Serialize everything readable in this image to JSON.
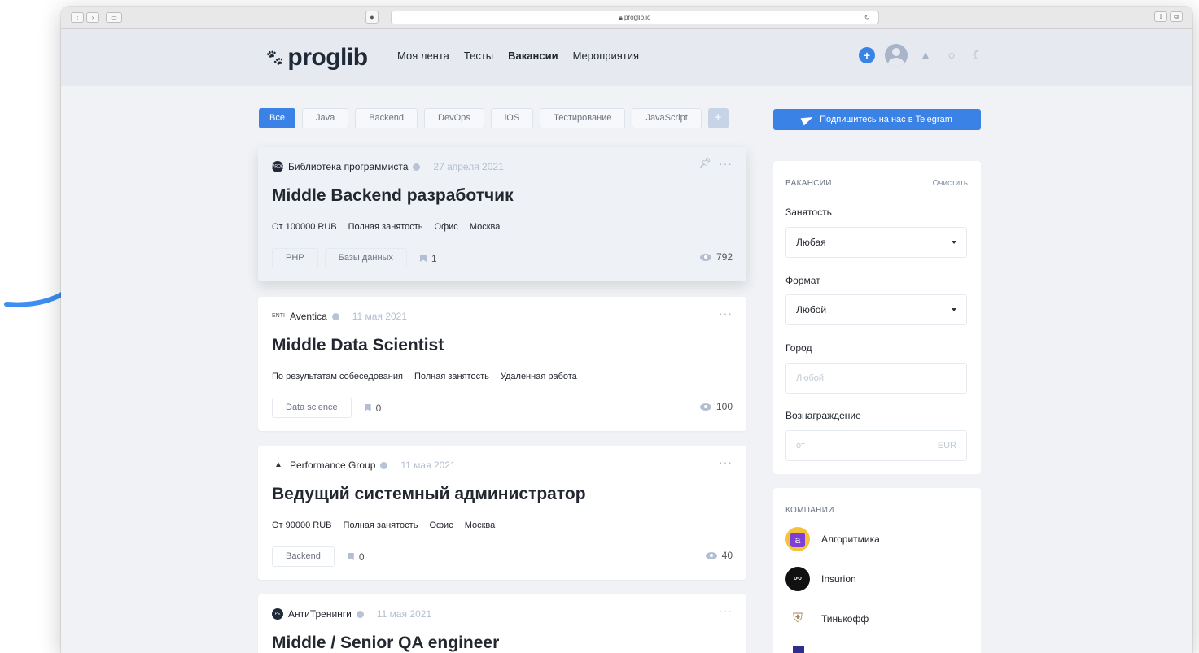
{
  "browser": {
    "url": "proglib.io"
  },
  "header": {
    "logo": "proglib",
    "nav": [
      "Моя лента",
      "Тесты",
      "Вакансии",
      "Мероприятия"
    ]
  },
  "filters": [
    "Все",
    "Java",
    "Backend",
    "DevOps",
    "iOS",
    "Тестирование",
    "JavaScript",
    "+"
  ],
  "jobs": [
    {
      "company": "Библиотека программиста",
      "date": "27 апреля 2021",
      "title": "Middle Backend разработчик",
      "meta": [
        "От 100000 RUB",
        "Полная занятость",
        "Офис",
        "Москва"
      ],
      "tags": [
        "PHP",
        "Базы данных"
      ],
      "bookmarks": "1",
      "views": "792"
    },
    {
      "company": "Aventica",
      "date": "11 мая 2021",
      "title": "Middle Data Scientist",
      "meta": [
        "По результатам собеседования",
        "Полная занятость",
        "Удаленная работа"
      ],
      "tags": [
        "Data science"
      ],
      "bookmarks": "0",
      "views": "100"
    },
    {
      "company": "Performance Group",
      "date": "11 мая 2021",
      "title": "Ведущий системный администратор",
      "meta": [
        "От 90000 RUB",
        "Полная занятость",
        "Офис",
        "Москва"
      ],
      "tags": [
        "Backend"
      ],
      "bookmarks": "0",
      "views": "40"
    },
    {
      "company": "АнтиТренинги",
      "date": "11 мая 2021",
      "title": "Middle / Senior QA engineer"
    }
  ],
  "telegram": {
    "label": "Подпишитесь на нас в Telegram"
  },
  "vacancy_filter": {
    "title": "ВАКАНСИИ",
    "clear": "Очистить",
    "employment_label": "Занятость",
    "employment_value": "Любая",
    "format_label": "Формат",
    "format_value": "Любой",
    "city_label": "Город",
    "city_placeholder": "Любой",
    "salary_label": "Вознаграждение",
    "salary_placeholder": "от",
    "salary_currency": "EUR"
  },
  "companies": {
    "title": "КОМПАНИИ",
    "items": [
      "Алгоритмика",
      "Insurion",
      "Тинькофф"
    ]
  },
  "colors": {
    "accent": "#3b82e7",
    "arrow": "#3d8ef0",
    "page_bg": "#f0f2f5"
  }
}
